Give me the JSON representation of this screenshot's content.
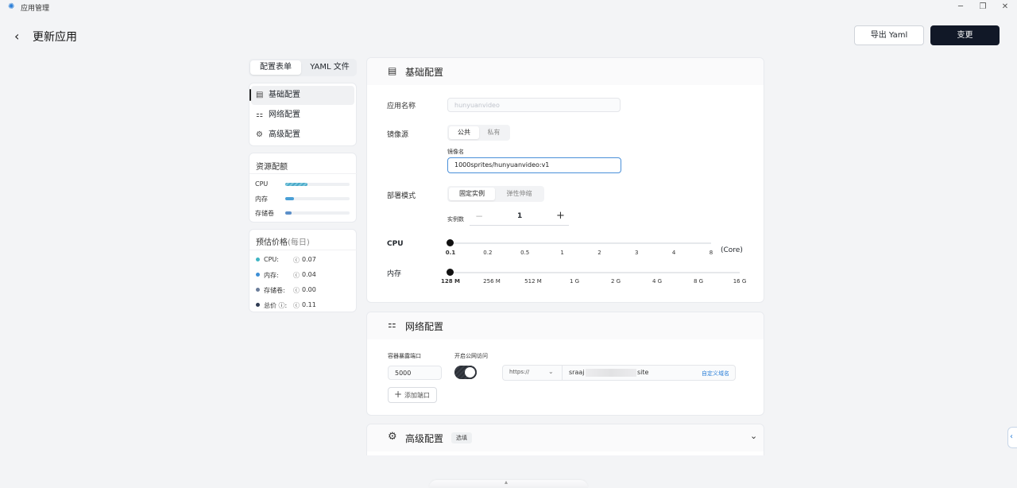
{
  "app": {
    "title": "应用管理"
  },
  "page": {
    "title": "更新应用",
    "export_label": "导出 Yaml",
    "submit_label": "变更"
  },
  "side_tabs": [
    "配置表单",
    "YAML 文件"
  ],
  "nav": [
    "基础配置",
    "网络配置",
    "高级配置"
  ],
  "resources": {
    "title": "资源配额",
    "items": [
      {
        "label": "CPU",
        "fill": 0.35,
        "color": "#4aa9c9"
      },
      {
        "label": "内存",
        "fill": 0.14,
        "color": "#4a9fd6"
      },
      {
        "label": "存储卷",
        "fill": 0.1,
        "color": "#5b8fc9"
      }
    ]
  },
  "price": {
    "title": "预估价格",
    "subtitle": "(每日)",
    "rows": [
      {
        "label": "CPU:",
        "value": "0.07",
        "color": "#3fb5c4"
      },
      {
        "label": "内存:",
        "value": "0.04",
        "color": "#3d8fd6"
      },
      {
        "label": "存储卷:",
        "value": "0.00",
        "color": "#6b7d9a"
      },
      {
        "label": "总价 ⓘ:",
        "value": "0.11",
        "color": "#2f3b52"
      }
    ]
  },
  "basic": {
    "title": "基础配置",
    "app_name_label": "应用名称",
    "app_name_placeholder": "hunyuanvideo",
    "image_source_label": "镜像源",
    "image_source_options": [
      "公共",
      "私有"
    ],
    "image_name_label": "镜像名",
    "image_name_value": "1000sprites/hunyuanvideo:v1",
    "deploy_mode_label": "部署模式",
    "deploy_mode_options": [
      "固定实例",
      "弹性伸缩"
    ],
    "instances_label": "实例数",
    "instances_value": "1",
    "cpu_label": "CPU",
    "cpu_ticks": [
      "0.1",
      "0.2",
      "0.5",
      "1",
      "2",
      "3",
      "4",
      "8"
    ],
    "cpu_unit": "(Core)",
    "cpu_value": "0.1",
    "mem_label": "内存",
    "mem_ticks": [
      "128 M",
      "256 M",
      "512 M",
      "1 G",
      "2 G",
      "4 G",
      "8 G",
      "16 G"
    ],
    "mem_value": "128 M"
  },
  "network": {
    "title": "网络配置",
    "port_label": "容器暴露端口",
    "port_value": "5000",
    "public_label": "开启公网访问",
    "public_enabled": true,
    "protocol": "https://",
    "domain_start": "sraaj",
    "domain_end": "site",
    "custom_domain": "自定义域名",
    "add_port": "添加端口"
  },
  "advanced": {
    "title": "高级配置",
    "tag": "选填"
  }
}
